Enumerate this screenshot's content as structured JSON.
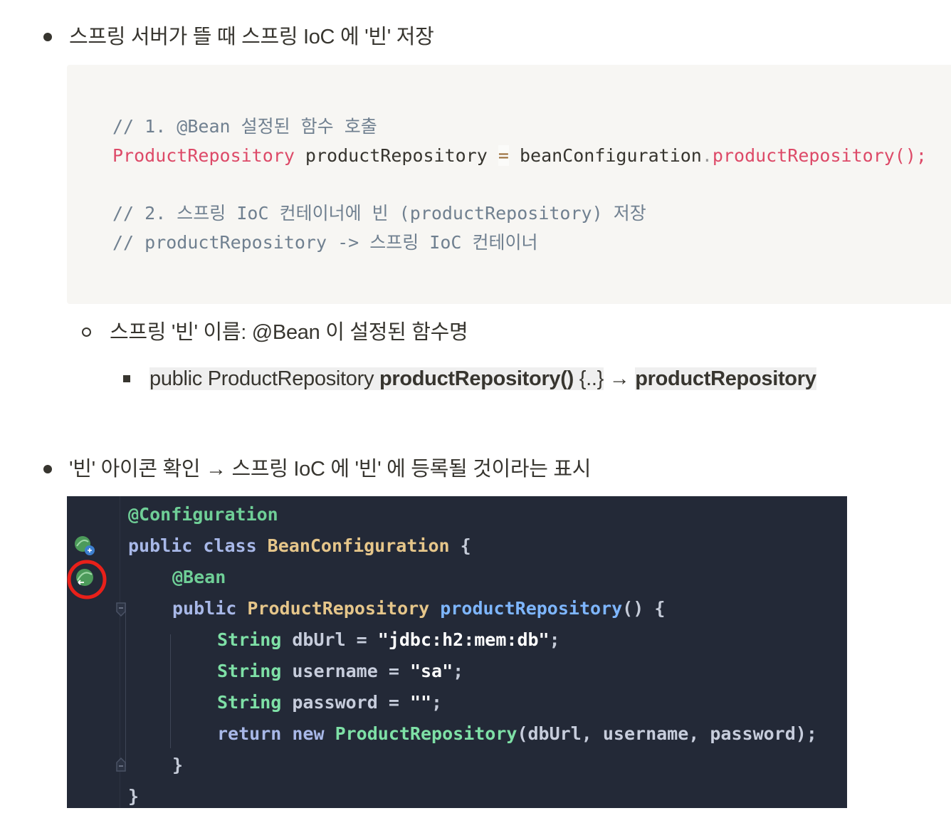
{
  "section1": {
    "heading": "스프링 서버가 뜰 때 스프링 IoC 에 '빈' 저장",
    "code": {
      "line1_comment": "// 1. @Bean 설정된 함수 호출",
      "line2_type": "ProductRepository",
      "line2_var": " productRepository ",
      "line2_eq": "=",
      "line2_obj": " beanConfiguration",
      "line2_dot": ".",
      "line2_method": "productRepository();",
      "line3_comment": "// 2. 스프링 IoC 컨테이너에 빈 (productRepository) 저장",
      "line4_comment": "// productRepository -> 스프링 IoC 컨테이너"
    },
    "sub_item": "스프링 '빈' 이름: @Bean 이 설정된 함수명",
    "sub_sub_item": {
      "part1": "public ProductRepository ",
      "part2_bold": "productRepository()",
      "part3": " {..}",
      "arrow": " → ",
      "part4_bold": "productRepository"
    }
  },
  "section2": {
    "heading": "'빈' 아이콘 확인 → 스프링 IoC 에 '빈' 에 등록될 것이라는 표시",
    "ide": {
      "l1": "@Configuration",
      "l2_kw": "public class ",
      "l2_cls": "BeanConfiguration",
      "l2_end": " {",
      "l3": "@Bean",
      "l4_kw": "public ",
      "l4_type": "ProductRepository ",
      "l4_fn": "productRepository",
      "l4_end": "() {",
      "l5_type": "String ",
      "l5_var": "dbUrl = ",
      "l5_str": "\"jdbc:h2:mem:db\"",
      "l5_end": ";",
      "l6_type": "String ",
      "l6_var": "username = ",
      "l6_str": "\"sa\"",
      "l6_end": ";",
      "l7_type": "String ",
      "l7_var": "password = ",
      "l7_str": "\"\"",
      "l7_end": ";",
      "l8_kw": "return new ",
      "l8_type": "ProductRepository",
      "l8_rest": "(dbUrl, username, password);",
      "l9": "}",
      "l10": "}"
    }
  },
  "colors": {
    "code_bg": "#f7f6f3",
    "ide_bg": "#232937",
    "highlight_circle": "#e8201a",
    "bean_icon": "#4c9a5a"
  }
}
